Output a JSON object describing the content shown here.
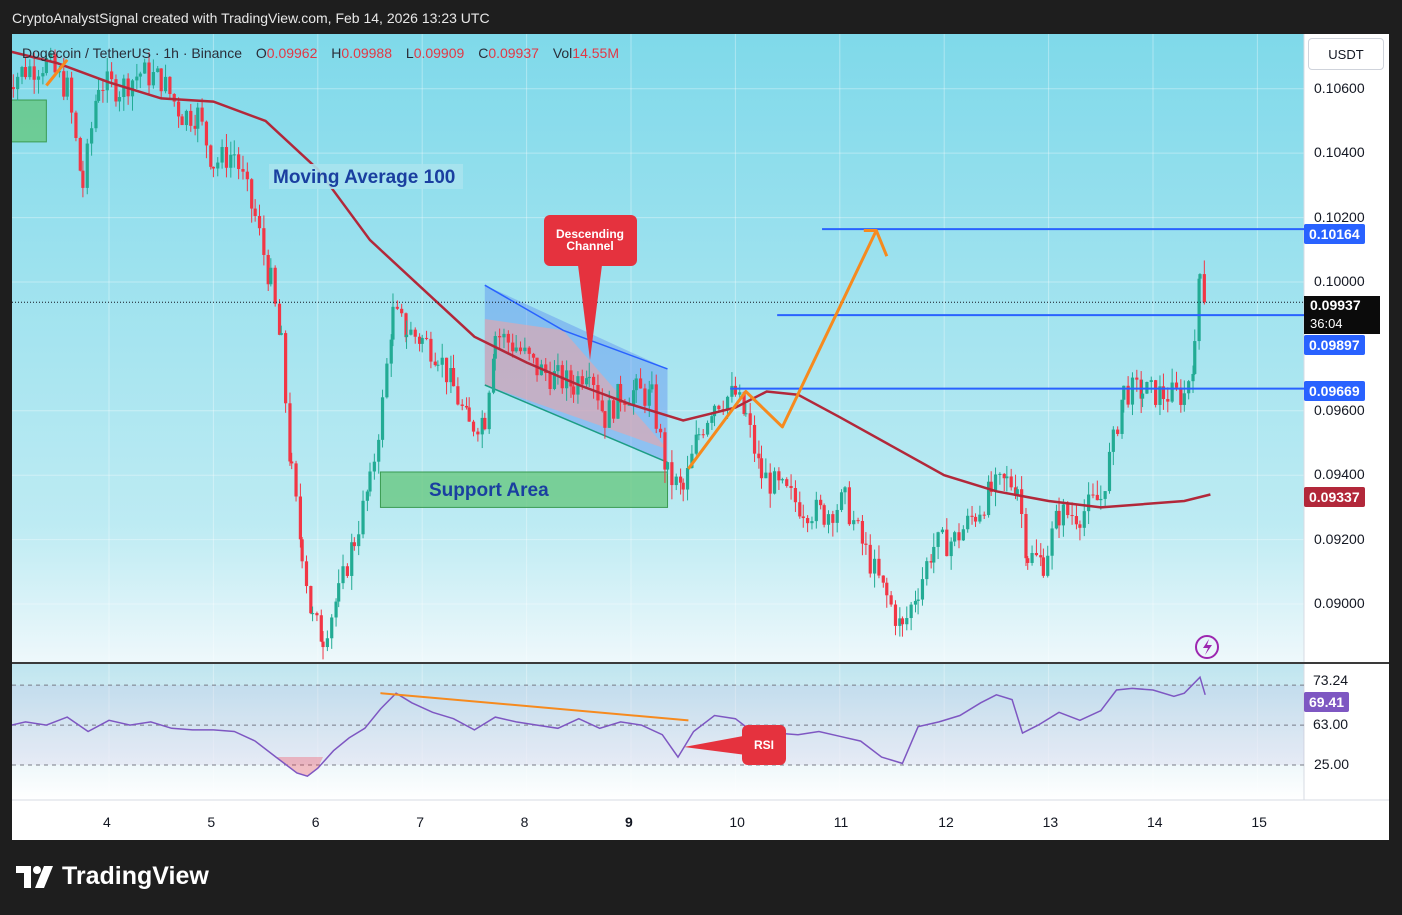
{
  "header": {
    "credit": "CryptoAnalystSignal created with TradingView.com, Feb 14, 2026 13:23 UTC"
  },
  "legend": {
    "symbol": "Dogecoin / TetherUS · 1h · Binance",
    "open_label": "O",
    "open": "0.09962",
    "high_label": "H",
    "high": "0.09988",
    "low_label": "L",
    "low": "0.09909",
    "close_label": "C",
    "close": "0.09937",
    "vol_label": "Vol",
    "vol": "14.55M"
  },
  "currency_button": "USDT",
  "annotations": {
    "moving_average": "Moving Average 100",
    "descending_channel_line1": "Descending",
    "descending_channel_line2": "Channel",
    "support_area": "Support Area",
    "rsi": "RSI"
  },
  "price_tags": {
    "target": "0.10164",
    "current": "0.09937",
    "countdown": "36:04",
    "resistance": "0.09897",
    "breakout": "0.09669",
    "ma100": "0.09337"
  },
  "rsi_tags": {
    "upper": "73.24",
    "value": "69.41",
    "lower": "63.00"
  },
  "branding": {
    "logo_text": "TradingView"
  },
  "colors": {
    "up": "#22ab94",
    "down": "#f23645",
    "ma": "#b2283a",
    "level_line": "#2962ff",
    "arrow": "#f68a1e",
    "rsi_line": "#7e57c2",
    "support": "#63c67a",
    "callout": "#e5323e"
  },
  "chart_data": {
    "type": "candlestick",
    "title": "",
    "xlabel": "",
    "ylabel": "",
    "x_ticks": [
      "4",
      "5",
      "6",
      "7",
      "8",
      "9",
      "10",
      "11",
      "12",
      "13",
      "14",
      "15"
    ],
    "y_ticks": [
      "0.10600",
      "0.10400",
      "0.10200",
      "0.10000",
      "0.09600",
      "0.09400",
      "0.09200",
      "0.09000"
    ],
    "ylim": [
      0.0882,
      0.1077
    ],
    "x_range": [
      3.0,
      15.5
    ],
    "grid": true,
    "price_path": [
      [
        3.0,
        0.1062
      ],
      [
        3.2,
        0.1066
      ],
      [
        3.4,
        0.1068
      ],
      [
        3.6,
        0.106
      ],
      [
        3.75,
        0.103
      ],
      [
        3.9,
        0.1062
      ],
      [
        4.1,
        0.106
      ],
      [
        4.3,
        0.1065
      ],
      [
        4.5,
        0.1063
      ],
      [
        4.7,
        0.1052
      ],
      [
        4.85,
        0.1052
      ],
      [
        5.0,
        0.1037
      ],
      [
        5.2,
        0.104
      ],
      [
        5.4,
        0.102
      ],
      [
        5.55,
        0.1
      ],
      [
        5.65,
        0.098
      ],
      [
        5.75,
        0.094
      ],
      [
        5.85,
        0.0917
      ],
      [
        5.95,
        0.0895
      ],
      [
        6.05,
        0.089
      ],
      [
        6.2,
        0.0903
      ],
      [
        6.35,
        0.092
      ],
      [
        6.5,
        0.0937
      ],
      [
        6.62,
        0.0962
      ],
      [
        6.72,
        0.099
      ],
      [
        6.85,
        0.0985
      ],
      [
        7.0,
        0.0982
      ],
      [
        7.15,
        0.0978
      ],
      [
        7.3,
        0.0967
      ],
      [
        7.45,
        0.0955
      ],
      [
        7.6,
        0.0958
      ],
      [
        7.7,
        0.0984
      ],
      [
        7.9,
        0.098
      ],
      [
        8.1,
        0.0973
      ],
      [
        8.3,
        0.097
      ],
      [
        8.45,
        0.0968
      ],
      [
        8.6,
        0.0975
      ],
      [
        8.75,
        0.0958
      ],
      [
        8.9,
        0.0965
      ],
      [
        9.05,
        0.0966
      ],
      [
        9.2,
        0.0964
      ],
      [
        9.35,
        0.094
      ],
      [
        9.5,
        0.0935
      ],
      [
        9.65,
        0.0953
      ],
      [
        9.8,
        0.0963
      ],
      [
        10.0,
        0.0965
      ],
      [
        10.1,
        0.0958
      ],
      [
        10.25,
        0.094
      ],
      [
        10.45,
        0.0935
      ],
      [
        10.65,
        0.093
      ],
      [
        10.85,
        0.0928
      ],
      [
        11.05,
        0.0932
      ],
      [
        11.25,
        0.0916
      ],
      [
        11.45,
        0.0902
      ],
      [
        11.6,
        0.0892
      ],
      [
        11.75,
        0.0905
      ],
      [
        11.9,
        0.0918
      ],
      [
        12.1,
        0.092
      ],
      [
        12.3,
        0.0928
      ],
      [
        12.45,
        0.0935
      ],
      [
        12.6,
        0.0938
      ],
      [
        12.7,
        0.0937
      ],
      [
        12.8,
        0.0915
      ],
      [
        12.95,
        0.0913
      ],
      [
        13.1,
        0.0928
      ],
      [
        13.3,
        0.0928
      ],
      [
        13.5,
        0.0933
      ],
      [
        13.62,
        0.095
      ],
      [
        13.72,
        0.0966
      ],
      [
        13.9,
        0.0966
      ],
      [
        14.1,
        0.0965
      ],
      [
        14.3,
        0.0965
      ],
      [
        14.4,
        0.0978
      ],
      [
        14.45,
        0.1006
      ],
      [
        14.5,
        0.0994
      ]
    ],
    "moving_average_100": [
      [
        3.0,
        0.1072
      ],
      [
        3.5,
        0.1068
      ],
      [
        4.0,
        0.1062
      ],
      [
        4.5,
        0.1057
      ],
      [
        5.0,
        0.1056
      ],
      [
        5.5,
        0.105
      ],
      [
        6.0,
        0.1035
      ],
      [
        6.5,
        0.1013
      ],
      [
        7.0,
        0.0998
      ],
      [
        7.5,
        0.0983
      ],
      [
        8.0,
        0.0975
      ],
      [
        8.5,
        0.0968
      ],
      [
        9.0,
        0.0962
      ],
      [
        9.5,
        0.0957
      ],
      [
        10.0,
        0.0961
      ],
      [
        10.3,
        0.0966
      ],
      [
        10.6,
        0.0965
      ],
      [
        11.0,
        0.0958
      ],
      [
        11.5,
        0.0949
      ],
      [
        12.0,
        0.094
      ],
      [
        12.5,
        0.0935
      ],
      [
        13.0,
        0.0932
      ],
      [
        13.5,
        0.093
      ],
      [
        13.9,
        0.0931
      ],
      [
        14.3,
        0.0932
      ],
      [
        14.55,
        0.0934
      ]
    ],
    "horizontal_levels": [
      {
        "price": 0.10164,
        "x_from": 10.83
      },
      {
        "price": 0.09897,
        "x_from": 10.4
      },
      {
        "price": 0.09669,
        "x_from": 9.95
      }
    ],
    "descending_channel": {
      "upper": [
        [
          7.6,
          0.0999
        ],
        [
          8.35,
          0.0985
        ],
        [
          9.35,
          0.0973
        ]
      ],
      "lower": [
        [
          7.6,
          0.0968
        ],
        [
          9.35,
          0.0944
        ]
      ]
    },
    "support_area": {
      "x": [
        6.6,
        9.35
      ],
      "price": [
        0.093,
        0.0941
      ]
    },
    "projection_path": [
      [
        9.55,
        0.0942
      ],
      [
        10.1,
        0.0966
      ],
      [
        10.45,
        0.0955
      ],
      [
        11.35,
        0.1016
      ],
      [
        11.45,
        0.1008
      ]
    ],
    "rsi": {
      "levels": [
        25,
        50,
        75
      ],
      "ylim": [
        10,
        82
      ],
      "values": [
        [
          3.0,
          49
        ],
        [
          3.2,
          52
        ],
        [
          3.4,
          50
        ],
        [
          3.6,
          55
        ],
        [
          3.8,
          46
        ],
        [
          4.0,
          53
        ],
        [
          4.2,
          50
        ],
        [
          4.4,
          52
        ],
        [
          4.6,
          48
        ],
        [
          4.8,
          47
        ],
        [
          5.0,
          47
        ],
        [
          5.2,
          46
        ],
        [
          5.4,
          40
        ],
        [
          5.6,
          30
        ],
        [
          5.8,
          20
        ],
        [
          5.9,
          18
        ],
        [
          6.0,
          23
        ],
        [
          6.15,
          34
        ],
        [
          6.3,
          42
        ],
        [
          6.45,
          48
        ],
        [
          6.6,
          60
        ],
        [
          6.75,
          70
        ],
        [
          6.9,
          64
        ],
        [
          7.1,
          58
        ],
        [
          7.3,
          54
        ],
        [
          7.5,
          47
        ],
        [
          7.7,
          55
        ],
        [
          7.9,
          52
        ],
        [
          8.1,
          50
        ],
        [
          8.3,
          48
        ],
        [
          8.5,
          54
        ],
        [
          8.7,
          48
        ],
        [
          8.9,
          52
        ],
        [
          9.1,
          50
        ],
        [
          9.3,
          44
        ],
        [
          9.45,
          30
        ],
        [
          9.6,
          46
        ],
        [
          9.8,
          56
        ],
        [
          10.0,
          54
        ],
        [
          10.2,
          44
        ],
        [
          10.4,
          45
        ],
        [
          10.6,
          44
        ],
        [
          10.8,
          46
        ],
        [
          11.0,
          43
        ],
        [
          11.2,
          40
        ],
        [
          11.4,
          30
        ],
        [
          11.6,
          26
        ],
        [
          11.75,
          49
        ],
        [
          11.95,
          52
        ],
        [
          12.15,
          56
        ],
        [
          12.35,
          64
        ],
        [
          12.5,
          69
        ],
        [
          12.65,
          66
        ],
        [
          12.75,
          45
        ],
        [
          12.9,
          50
        ],
        [
          13.1,
          58
        ],
        [
          13.3,
          53
        ],
        [
          13.5,
          59
        ],
        [
          13.65,
          72
        ],
        [
          13.8,
          73
        ],
        [
          14.0,
          72
        ],
        [
          14.2,
          68
        ],
        [
          14.3,
          70
        ],
        [
          14.45,
          80
        ],
        [
          14.5,
          69
        ]
      ],
      "divergence_line": [
        [
          6.6,
          70
        ],
        [
          9.55,
          53
        ]
      ]
    }
  }
}
